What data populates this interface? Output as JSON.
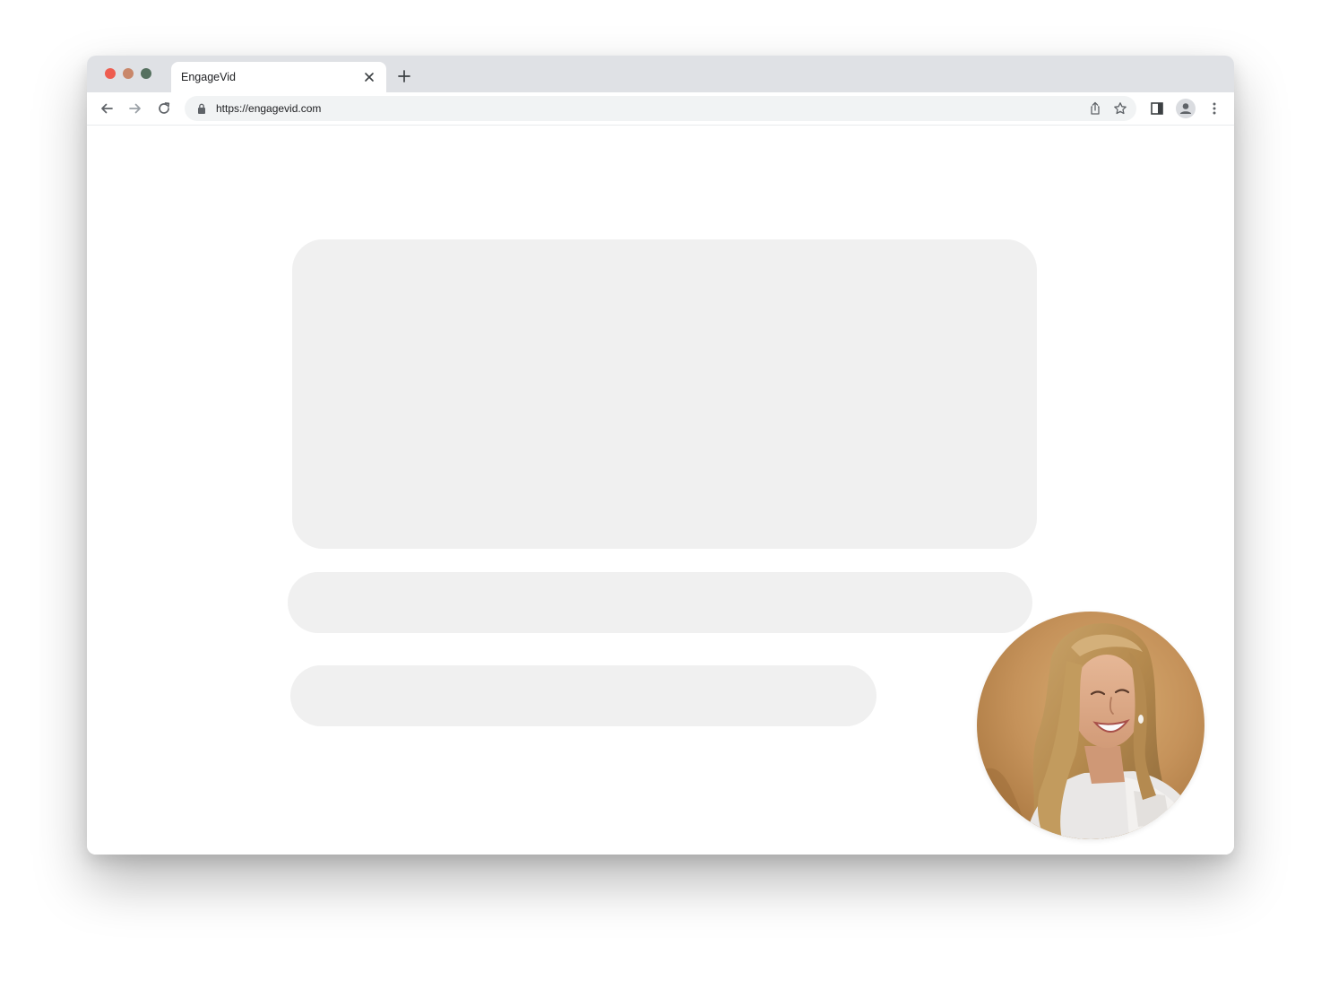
{
  "window": {
    "traffic_lights": {
      "close_color": "#ee5d50",
      "minimize_color": "#c9876a",
      "zoom_color": "#55705f"
    }
  },
  "tab": {
    "title": "EngageVid",
    "close_icon": "close-icon"
  },
  "toolbar": {
    "back_icon": "arrow-left-icon",
    "forward_icon": "arrow-right-icon",
    "reload_icon": "reload-icon",
    "new_tab_icon": "plus-icon"
  },
  "omnibox": {
    "url": "https://engagevid.com",
    "lock_icon": "lock-icon",
    "share_icon": "share-icon",
    "bookmark_icon": "star-icon"
  },
  "toolbar_right": {
    "side_panel_icon": "side-panel-icon",
    "profile_icon": "person-icon",
    "menu_icon": "kebab-menu-icon"
  },
  "content": {
    "placeholder_color": "#f0f0f0"
  },
  "video_bubble": {
    "subject": "webcam-video-of-smiling-woman"
  }
}
